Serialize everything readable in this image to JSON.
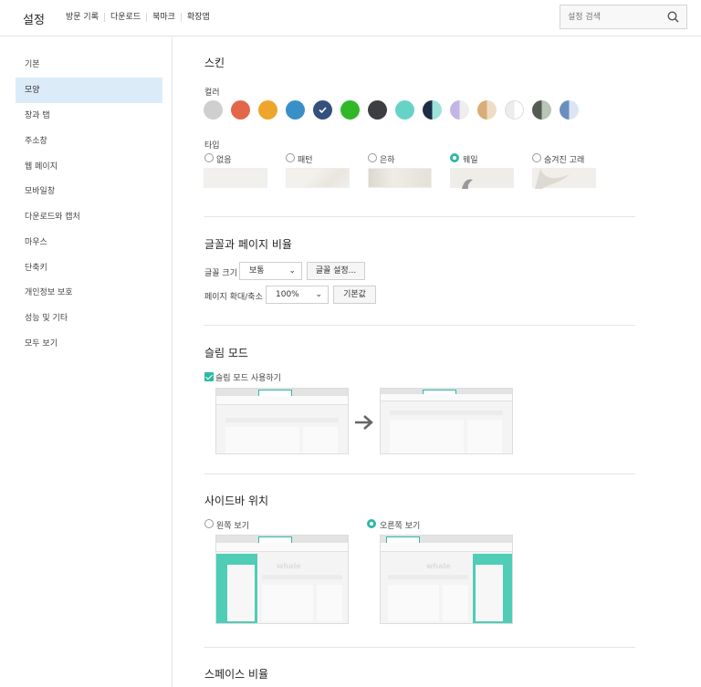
{
  "header": {
    "title": "설정",
    "nav": [
      "방문 기록",
      "다운로드",
      "북마크",
      "확장앱"
    ],
    "search_placeholder": "설정 검색"
  },
  "sidebar": {
    "items": [
      "기본",
      "모양",
      "창과 탭",
      "주소창",
      "웹 페이지",
      "모바일창",
      "다운로드와 캡처",
      "마우스",
      "단축키",
      "개인정보 보호",
      "성능 및 기타",
      "모두 보기"
    ],
    "active": "모양"
  },
  "skin": {
    "title": "스킨",
    "color_label": "컬러",
    "type_label": "타입",
    "colors": [
      "#cfcfcf",
      "#e4664a",
      "#eea52b",
      "#3a8fc7",
      "#34507c",
      "#30b829",
      "#3c3f42",
      "#67d3c6",
      "#1d2d47",
      "#c3b6e6",
      "#d9ad77",
      "#ececec",
      "#545b55",
      "#6b8fbd"
    ],
    "types": [
      "없음",
      "패턴",
      "은하",
      "웨일",
      "숨겨진 고래"
    ],
    "selected_type": "웨일"
  },
  "font": {
    "title": "글꼴과 페이지 비율",
    "size_label": "글꼴 크기",
    "size_value": "보통",
    "font_settings": "글꼴 설정...",
    "zoom_label": "페이지 확대/축소",
    "zoom_value": "100%",
    "reset": "기본값"
  },
  "slim": {
    "title": "슬림 모드",
    "checkbox": "슬림 모드 사용하기"
  },
  "sidebar_pos": {
    "title": "사이드바 위치",
    "left": "왼쪽 보기",
    "right": "오른쪽 보기",
    "selected": "오른쪽 보기",
    "watermark": "whale"
  },
  "space": {
    "title": "스페이스 비율"
  }
}
